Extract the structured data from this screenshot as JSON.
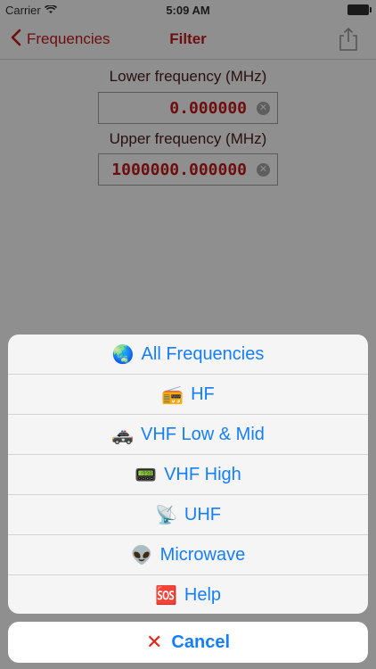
{
  "status_bar": {
    "carrier": "Carrier",
    "time": "5:09 AM"
  },
  "nav": {
    "back_label": "Frequencies",
    "title": "Filter"
  },
  "lower": {
    "label": "Lower frequency (MHz)",
    "value": "0.000000"
  },
  "upper": {
    "label": "Upper frequency (MHz)",
    "value": "1000000.000000"
  },
  "sheet": {
    "items": [
      {
        "emoji": "🌏",
        "label": "All Frequencies"
      },
      {
        "emoji": "📻",
        "label": "HF"
      },
      {
        "emoji": "🚓",
        "label": "VHF Low & Mid"
      },
      {
        "emoji": "📟",
        "label": "VHF High"
      },
      {
        "emoji": "📡",
        "label": "UHF"
      },
      {
        "emoji": "👽",
        "label": "Microwave"
      },
      {
        "emoji": "🆘",
        "label": "Help"
      }
    ],
    "cancel_icon": "✕",
    "cancel_label": "Cancel"
  },
  "colors": {
    "accent_blue": "#157efb",
    "nav_red": "#6e0d0d",
    "cancel_x": "#e2231a"
  }
}
